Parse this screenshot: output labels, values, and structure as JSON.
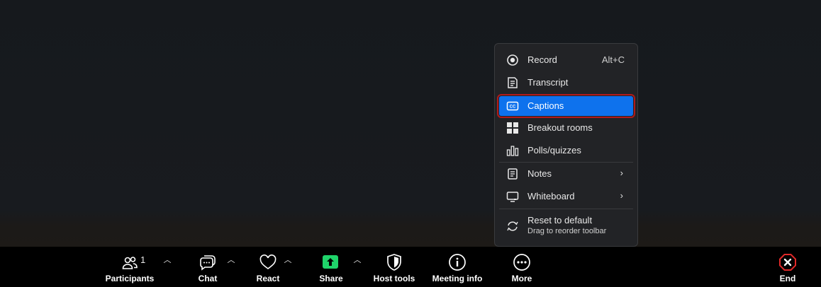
{
  "menu": {
    "items": [
      {
        "label": "Record",
        "shortcut": "Alt+C",
        "icon": "record-icon"
      },
      {
        "label": "Transcript",
        "icon": "transcript-icon"
      },
      {
        "label": "Captions",
        "icon": "captions-icon",
        "selected": true
      },
      {
        "label": "Breakout rooms",
        "icon": "breakout-rooms-icon"
      },
      {
        "label": "Polls/quizzes",
        "icon": "polls-icon"
      },
      {
        "label": "Notes",
        "icon": "notes-icon",
        "submenu": true
      },
      {
        "label": "Whiteboard",
        "icon": "whiteboard-icon",
        "submenu": true
      }
    ],
    "reset": {
      "label": "Reset to default",
      "sublabel": "Drag to reorder toolbar",
      "icon": "reset-icon"
    }
  },
  "toolbar": {
    "participants": {
      "label": "Participants",
      "count": "1"
    },
    "chat": {
      "label": "Chat"
    },
    "react": {
      "label": "React"
    },
    "share": {
      "label": "Share"
    },
    "host_tools": {
      "label": "Host tools"
    },
    "meeting_info": {
      "label": "Meeting info"
    },
    "more": {
      "label": "More"
    },
    "end": {
      "label": "End"
    }
  },
  "colors": {
    "accent": "#0e72ed",
    "share_green": "#22c55e",
    "end_red": "#e02828",
    "highlight_border": "#b01a1a"
  }
}
